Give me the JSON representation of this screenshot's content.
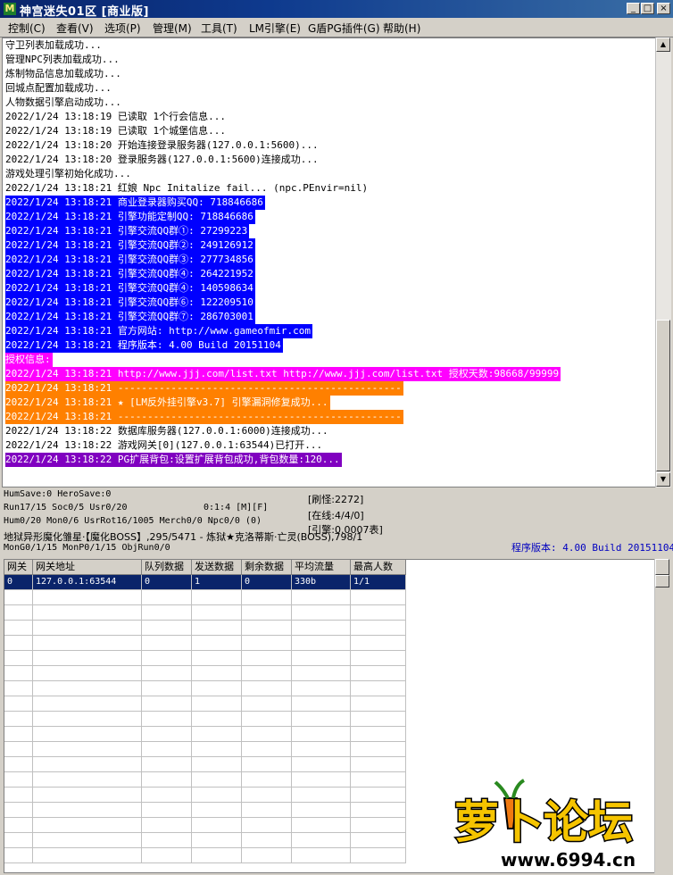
{
  "window": {
    "title": "神宫迷失01区 [商业版]",
    "app_icon": "M",
    "buttons": [
      "_",
      "□",
      "×"
    ]
  },
  "menu": [
    "控制(C)",
    "查看(V)",
    "选项(P)",
    "管理(M)",
    "工具(T)",
    "LM引擎(E)",
    "G盾PG插件(G)",
    "帮助(H)"
  ],
  "log_lines": [
    {
      "text": "守卫列表加载成功...",
      "style": "normal"
    },
    {
      "text": "管理NPC列表加载成功...",
      "style": "normal"
    },
    {
      "text": "炼制物品信息加载成功...",
      "style": "normal"
    },
    {
      "text": "回城点配置加载成功...",
      "style": "normal"
    },
    {
      "text": "人物数据引擎启动成功...",
      "style": "normal"
    },
    {
      "text": "2022/1/24 13:18:19 已读取 1个行会信息...",
      "style": "normal"
    },
    {
      "text": "2022/1/24 13:18:19 已读取 1个城堡信息...",
      "style": "normal"
    },
    {
      "text": "2022/1/24 13:18:20 开始连接登录服务器(127.0.0.1:5600)...",
      "style": "normal"
    },
    {
      "text": "2022/1/24 13:18:20 登录服务器(127.0.0.1:5600)连接成功...",
      "style": "normal"
    },
    {
      "text": "游戏处理引擎初始化成功...",
      "style": "normal"
    },
    {
      "text": "2022/1/24 13:18:21 红娘 Npc Initalize fail... (npc.PEnvir=nil)",
      "style": "normal"
    },
    {
      "text": "2022/1/24 13:18:21 商业登录器购买QQ: 718846686",
      "style": "blue"
    },
    {
      "text": "2022/1/24 13:18:21 引擎功能定制QQ: 718846686",
      "style": "blue"
    },
    {
      "text": "2022/1/24 13:18:21 引擎交流QQ群①: 27299223",
      "style": "blue"
    },
    {
      "text": "2022/1/24 13:18:21 引擎交流QQ群②: 249126912",
      "style": "blue"
    },
    {
      "text": "2022/1/24 13:18:21 引擎交流QQ群③: 277734856",
      "style": "blue"
    },
    {
      "text": "2022/1/24 13:18:21 引擎交流QQ群④: 264221952",
      "style": "blue"
    },
    {
      "text": "2022/1/24 13:18:21 引擎交流QQ群④: 140598634",
      "style": "blue"
    },
    {
      "text": "2022/1/24 13:18:21 引擎交流QQ群⑥: 122209510",
      "style": "blue"
    },
    {
      "text": "2022/1/24 13:18:21 引擎交流QQ群⑦: 286703001",
      "style": "blue"
    },
    {
      "text": "2022/1/24 13:18:21 官方网站: http://www.gameofmir.com",
      "style": "blue"
    },
    {
      "text": "2022/1/24 13:18:21 程序版本: 4.00 Build 20151104",
      "style": "blue"
    },
    {
      "text": "授权信息:",
      "style": "magenta"
    },
    {
      "text": "2022/1/24 13:18:21 http://www.jjj.com/list.txt http://www.jjj.com/list.txt 授权天数:98668/99999",
      "style": "magenta"
    },
    {
      "text": "2022/1/24 13:18:21 ------------------------------------------------",
      "style": "orange"
    },
    {
      "text": "2022/1/24 13:18:21 ★ [LM反外挂引擎v3.7] 引擎漏洞修复成功...",
      "style": "orange"
    },
    {
      "text": "2022/1/24 13:18:21 ------------------------------------------------",
      "style": "orange"
    },
    {
      "text": "2022/1/24 13:18:22 数据库服务器(127.0.0.1:6000)连接成功...",
      "style": "normal"
    },
    {
      "text": "2022/1/24 13:18:22 游戏网关[0](127.0.0.1:63544)已打开...",
      "style": "normal"
    },
    {
      "text": "2022/1/24 13:18:22 PG扩展背包:设置扩展背包成功,背包数量:120...",
      "style": "purple"
    }
  ],
  "status": {
    "line1": "HumSave:0 HeroSave:0",
    "line2a": "Run17/15 Soc0/5 Usr0/20",
    "line2b": "0:1:4 [M][F]",
    "line3": "Hum0/20 Mon0/6 UsrRot16/1005 Merch0/0 Npc0/0 (0)",
    "line4": "地狱异形魔化雏星·【魔化BOSS】,295/5471 - 炼狱★克洛蒂斯·亡灵(BOSS),798/1",
    "line5": "MonG0/1/15 MonP0/1/15 ObjRun0/0",
    "refresh": "[刷怪:2272]",
    "online": "[在线:4/4/0]",
    "engine": "[引擎:0.0007表]",
    "version": "程序版本: 4.00 Build 20151104"
  },
  "grid": {
    "headers": [
      "网关",
      "网关地址",
      "队列数据",
      "发送数据",
      "剩余数据",
      "平均流量",
      "最高人数"
    ],
    "rows": [
      [
        "0",
        "127.0.0.1:63544",
        "0",
        "1",
        "0",
        "330b",
        "1/1"
      ]
    ]
  },
  "watermark": {
    "logo": "萝卜论坛",
    "url": "www.6994.cn"
  },
  "colors": {
    "blue": "#0000ff",
    "magenta": "#ff00ff",
    "orange": "#ff8000",
    "purple": "#8000c0"
  }
}
